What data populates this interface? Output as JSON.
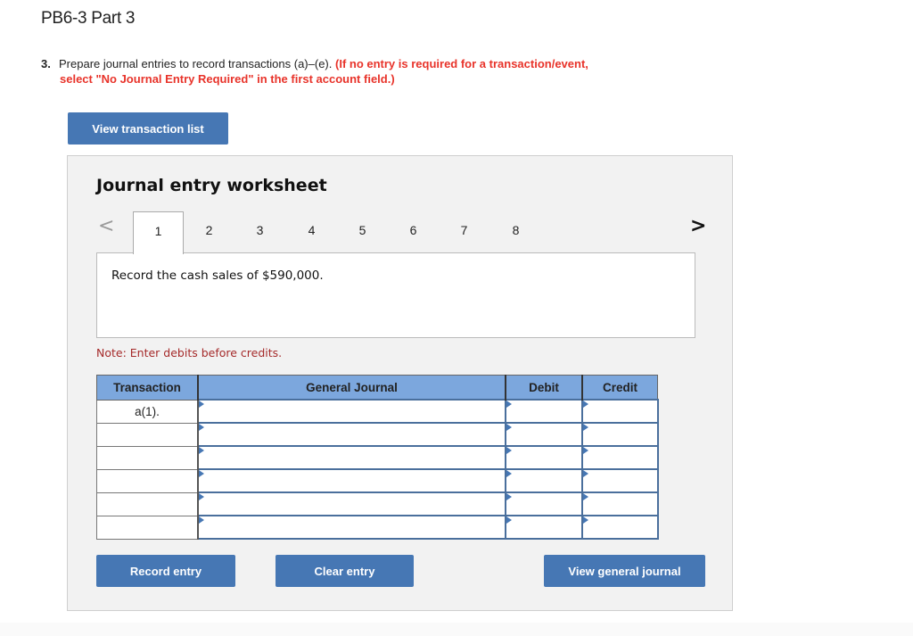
{
  "page": {
    "title": "PB6-3 Part 3"
  },
  "question": {
    "number": "3.",
    "text": "Prepare journal entries to record transactions (a)–(e).",
    "instruction_line1": "(If no entry is required for a transaction/event,",
    "instruction_line2": "select \"No Journal Entry Required\" in the first account field.)"
  },
  "buttons": {
    "view_transaction_list": "View transaction list",
    "record_entry": "Record entry",
    "clear_entry": "Clear entry",
    "view_general_journal": "View general journal"
  },
  "worksheet": {
    "title": "Journal entry worksheet",
    "prev_icon": "chevron-left-icon",
    "next_icon": "chevron-right-icon",
    "prev_glyph": "<",
    "next_glyph": ">",
    "tabs": [
      "1",
      "2",
      "3",
      "4",
      "5",
      "6",
      "7",
      "8"
    ],
    "active_tab": "1",
    "description": "Record the cash sales of $590,000.",
    "note": "Note: Enter debits before credits."
  },
  "journal_table": {
    "headers": [
      "Transaction",
      "General Journal",
      "Debit",
      "Credit"
    ],
    "rows": [
      {
        "transaction": "a(1).",
        "account": "",
        "debit": "",
        "credit": ""
      },
      {
        "transaction": "",
        "account": "",
        "debit": "",
        "credit": ""
      },
      {
        "transaction": "",
        "account": "",
        "debit": "",
        "credit": ""
      },
      {
        "transaction": "",
        "account": "",
        "debit": "",
        "credit": ""
      },
      {
        "transaction": "",
        "account": "",
        "debit": "",
        "credit": ""
      },
      {
        "transaction": "",
        "account": "",
        "debit": "",
        "credit": ""
      }
    ]
  },
  "colors": {
    "button_blue": "#4677b4",
    "header_blue": "#7ca7dd",
    "instruction_red": "#e8332a",
    "note_red": "#a52a2a"
  }
}
